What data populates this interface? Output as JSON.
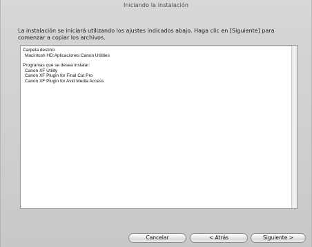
{
  "window": {
    "title": "Iniciando la instalación"
  },
  "intro": {
    "text": "La instalación se iniciará utilizando los ajustes indicados abajo. Haga clic en [Siguiente] para comenzar a copiar los archivos."
  },
  "summary": {
    "destination_label": "Carpeta destino:",
    "destination_value": "Macintosh HD:Aplicaciones:Canon Utilities",
    "programs_label": "Programas que se desea instalar:",
    "programs": [
      "Canon XF Utility",
      "Canon XF Plugin for Final Cut Pro",
      "Canon XF Plugin for Avid Media Access"
    ]
  },
  "buttons": {
    "cancel": "Cancelar",
    "back": "< Atrás",
    "next": "Siguiente >"
  }
}
